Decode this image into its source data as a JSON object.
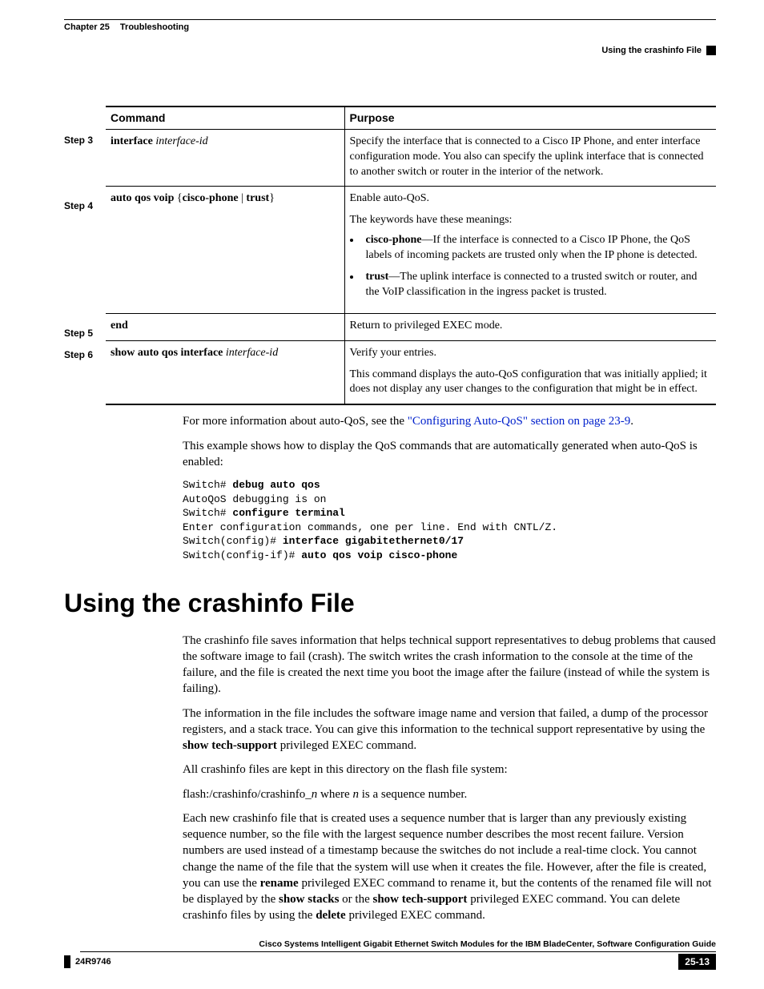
{
  "header": {
    "chapter_label": "Chapter 25",
    "chapter_title": "Troubleshooting",
    "right_title": "Using the crashinfo File"
  },
  "table": {
    "col_command": "Command",
    "col_purpose": "Purpose",
    "rows": [
      {
        "step": "Step 3",
        "cmd_bold": "interface",
        "cmd_italic": " interface-id",
        "purpose": "Specify the interface that is connected to a Cisco IP Phone, and enter interface configuration mode. You also can specify the uplink interface that is connected to another switch or router in the interior of the network."
      },
      {
        "step": "Step 4",
        "cmd_bold": "auto qos voip",
        "cmd_plain_after": " {",
        "cmd_bold2": "cisco-phone",
        "cmd_sep": " | ",
        "cmd_bold3": "trust",
        "cmd_plain_end": "}",
        "purpose_line1": "Enable auto-QoS.",
        "purpose_line2": "The keywords have these meanings:",
        "bullets": [
          {
            "kw": "cisco-phone",
            "text": "—If the interface is connected to a Cisco IP Phone, the QoS labels of incoming packets are trusted only when the IP phone is detected."
          },
          {
            "kw": "trust",
            "text": "—The uplink interface is connected to a trusted switch or router, and the VoIP classification in the ingress packet is trusted."
          }
        ]
      },
      {
        "step": "Step 5",
        "cmd_bold": "end",
        "purpose": "Return to privileged EXEC mode."
      },
      {
        "step": "Step 6",
        "cmd_bold": "show auto qos interface",
        "cmd_italic": " interface-id",
        "purpose_line1": "Verify your entries.",
        "purpose_line2": "This command displays the auto-QoS configuration that was initially applied; it does not display any user changes to the configuration that might be in effect."
      }
    ]
  },
  "para1_pre": "For more information about auto-QoS, see the ",
  "para1_link": "\"Configuring Auto-QoS\" section on page 23-9",
  "para1_post": ".",
  "para2": "This example shows how to display the QoS commands that are automatically generated when auto-QoS is enabled:",
  "code": {
    "l1_a": "Switch# ",
    "l1_b": "debug auto qos",
    "l2": "AutoQoS debugging is on",
    "l3_a": "Switch# ",
    "l3_b": "configure terminal",
    "l4": "Enter configuration commands, one per line. End with CNTL/Z.",
    "l5_a": "Switch(config)# ",
    "l5_b": "interface gigabitethernet0/17",
    "l6_a": "Switch(config-if)# ",
    "l6_b": "auto qos voip cisco-phone"
  },
  "section_title": "Using the crashinfo File",
  "section_paras": {
    "p1": "The crashinfo file saves information that helps technical support representatives to debug problems that caused the software image to fail (crash). The switch writes the crash information to the console at the time of the failure, and the file is created the next time you boot the image after the failure (instead of while the system is failing).",
    "p2_a": "The information in the file includes the software image name and version that failed, a dump of the processor registers, and a stack trace. You can give this information to the technical support representative by using the ",
    "p2_b": "show tech-support",
    "p2_c": " privileged EXEC command.",
    "p3": "All crashinfo files are kept in this directory on the flash file system:",
    "p4_a": "flash:/crashinfo/crashinfo_",
    "p4_b": "n",
    "p4_c": " where ",
    "p4_d": "n",
    "p4_e": " is a sequence number.",
    "p5_a": "Each new crashinfo file that is created uses a sequence number that is larger than any previously existing sequence number, so the file with the largest sequence number describes the most recent failure. Version numbers are used instead of a timestamp because the switches do not include a real-time clock. You cannot change the name of the file that the system will use when it creates the file. However, after the file is created, you can use the ",
    "p5_b": "rename",
    "p5_c": " privileged EXEC command to rename it, but the contents of the renamed file will not be displayed by the ",
    "p5_d": "show stacks",
    "p5_e": " or the ",
    "p5_f": "show tech-support",
    "p5_g": " privileged EXEC command. You can delete crashinfo files by using the ",
    "p5_h": "delete",
    "p5_i": " privileged EXEC command."
  },
  "footer": {
    "title": "Cisco Systems Intelligent Gigabit Ethernet Switch Modules for the IBM BladeCenter, Software Configuration Guide",
    "docnum": "24R9746",
    "page": "25-13"
  }
}
